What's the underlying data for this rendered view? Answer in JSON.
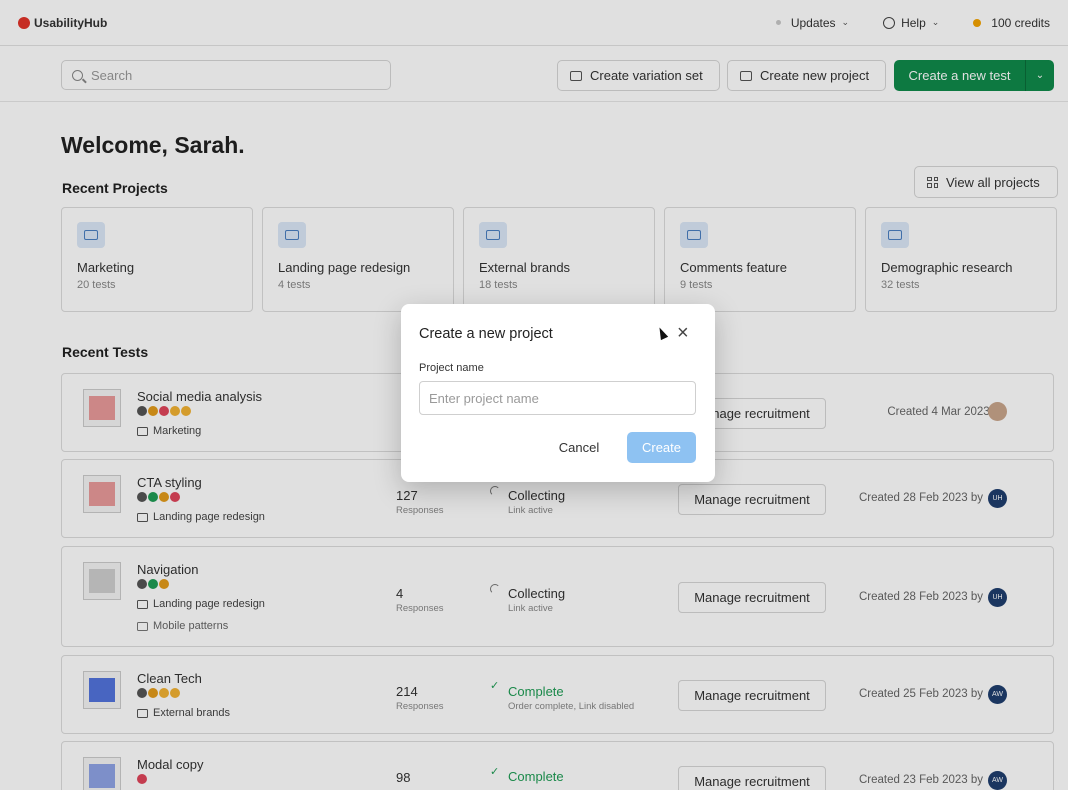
{
  "app": {
    "name": "UsabilityHub"
  },
  "topnav": {
    "updates": "Updates",
    "help": "Help",
    "credits": "100 credits"
  },
  "toolbar": {
    "search_placeholder": "Search",
    "variation_set": "Create variation set",
    "new_project": "Create new project",
    "new_test": "Create a new test"
  },
  "welcome": "Welcome, Sarah.",
  "recent_projects": {
    "title": "Recent Projects",
    "view_all": "View all projects",
    "items": [
      {
        "name": "Marketing",
        "count": "20 tests"
      },
      {
        "name": "Landing page redesign",
        "count": "4 tests"
      },
      {
        "name": "External brands",
        "count": "18 tests"
      },
      {
        "name": "Comments feature",
        "count": "9 tests"
      },
      {
        "name": "Demographic research",
        "count": "32 tests"
      }
    ]
  },
  "recent_tests": {
    "title": "Recent Tests",
    "manage_label": "Manage recruitment",
    "items": [
      {
        "name": "Social media analysis",
        "project": "Marketing",
        "responses": "",
        "responses_label": "",
        "status": "",
        "status_sub": "",
        "created": "Created 4 Mar 2023 by",
        "avatar": ""
      },
      {
        "name": "CTA styling",
        "project": "Landing page redesign",
        "responses": "127",
        "responses_label": "Responses",
        "status": "Collecting",
        "status_sub": "Link active",
        "created": "Created 28 Feb 2023 by",
        "avatar": "UH"
      },
      {
        "name": "Navigation",
        "project": "Landing page redesign",
        "variation": "Mobile patterns",
        "responses": "4",
        "responses_label": "Responses",
        "status": "Collecting",
        "status_sub": "Link active",
        "created": "Created 28 Feb 2023 by",
        "avatar": "UH"
      },
      {
        "name": "Clean Tech",
        "project": "External brands",
        "responses": "214",
        "responses_label": "Responses",
        "status": "Complete",
        "status_sub": "Order complete, Link disabled",
        "created": "Created 25 Feb 2023 by",
        "avatar": "AW"
      },
      {
        "name": "Modal copy",
        "project": "",
        "responses": "98",
        "responses_label": "",
        "status": "Complete",
        "status_sub": "",
        "created": "Created 23 Feb 2023 by",
        "avatar": "AW"
      }
    ]
  },
  "modal": {
    "title": "Create a new project",
    "field_label": "Project name",
    "placeholder": "Enter project name",
    "cancel": "Cancel",
    "create": "Create"
  },
  "colors": {
    "brand_green": "#0f8a4a",
    "create_disabled": "#8ec2f2",
    "complete_green": "#1f9d55",
    "folder_blue": "#4a7fc1"
  }
}
